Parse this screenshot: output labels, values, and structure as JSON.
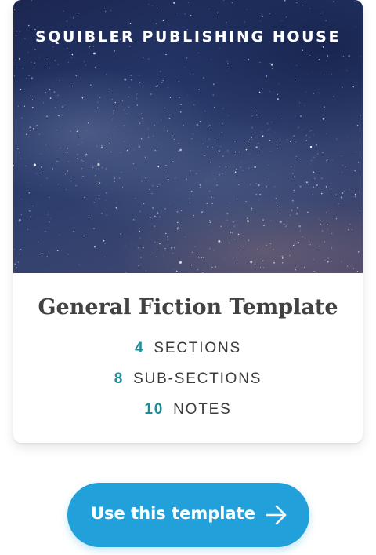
{
  "template_card": {
    "publisher": "SQUIBLER PUBLISHING HOUSE",
    "title": "General Fiction Template",
    "stats": [
      {
        "count": "4",
        "label": "SECTIONS"
      },
      {
        "count": "8",
        "label": "SUB-SECTIONS"
      },
      {
        "count": "10",
        "label": "NOTES"
      }
    ]
  },
  "cta": {
    "label": "Use this template",
    "icon": "arrow-right-icon"
  },
  "colors": {
    "accent": "#21a0da",
    "stat_number": "#168f99",
    "title_text": "#424242"
  }
}
